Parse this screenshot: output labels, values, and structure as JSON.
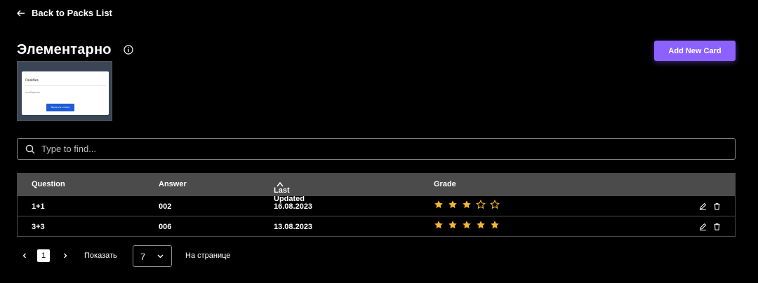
{
  "nav": {
    "back_label": "Back to Packs List"
  },
  "pack": {
    "title": "Элементарно",
    "cover": {
      "dialog_title": "Ошибка",
      "dialog_text": "сообщение",
      "dialog_button": "Вернуться к списку"
    }
  },
  "actions": {
    "add_card_label": "Add New Card"
  },
  "search": {
    "placeholder": "Type to find...",
    "value": ""
  },
  "table": {
    "columns": [
      "Question",
      "Answer",
      "Last Updated",
      "Grade"
    ],
    "sort": {
      "column": "Last Updated",
      "direction": "ascending"
    },
    "rows": [
      {
        "question": "1+1",
        "answer": "002",
        "updated": "16.08.2023",
        "grade": 3
      },
      {
        "question": "3+3",
        "answer": "006",
        "updated": "13.08.2023",
        "grade": 5
      }
    ],
    "max_grade": 5
  },
  "pagination": {
    "current_page": "1",
    "show_label": "Показать",
    "per_page": "7",
    "suffix_label": "На странице"
  },
  "colors": {
    "accent": "#8c61ff",
    "star": "#f5b731",
    "header_bg": "#4b4b4b",
    "background": "#000000"
  }
}
